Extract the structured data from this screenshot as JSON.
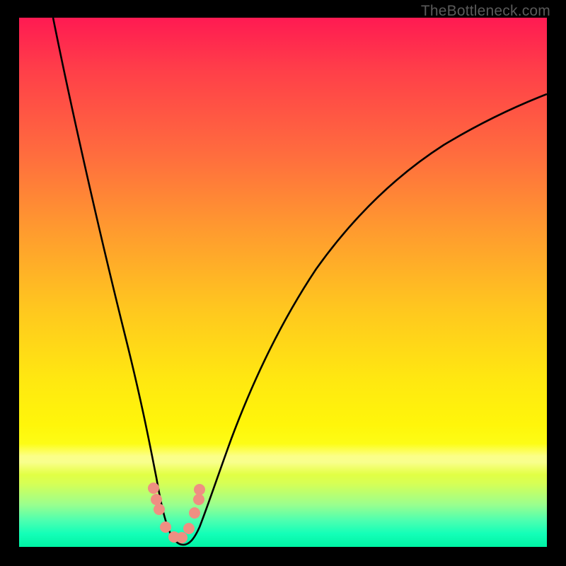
{
  "watermark": "TheBottleneck.com",
  "chart_data": {
    "type": "line",
    "title": "",
    "xlabel": "",
    "ylabel": "",
    "xlim": [
      0,
      100
    ],
    "ylim": [
      0,
      100
    ],
    "grid": false,
    "legend": false,
    "background_gradient": {
      "top": "#ff1a52",
      "mid": "#ffe711",
      "bottom": "#00f3a4"
    },
    "series": [
      {
        "name": "bottleneck-curve",
        "color": "#000000",
        "x": [
          6.5,
          9,
          12,
          15,
          18,
          21,
          23,
          25,
          26.8,
          28.5,
          30,
          31.5,
          33,
          35,
          38,
          42,
          47,
          53,
          60,
          68,
          77,
          87,
          100
        ],
        "y": [
          100,
          88,
          75,
          62,
          48,
          35,
          25,
          16,
          9,
          4,
          1.5,
          1.5,
          4,
          9.5,
          18,
          29,
          39.5,
          49,
          57,
          64,
          70,
          74.8,
          79
        ]
      },
      {
        "name": "marker-dots",
        "color": "#ef8f82",
        "type": "scatter",
        "x": [
          25.2,
          25.9,
          26.4,
          27.6,
          29.2,
          30.6,
          31.9,
          33.0,
          33.9,
          34.0
        ],
        "y": [
          11.0,
          8.8,
          7.0,
          3.8,
          2.0,
          2.0,
          3.7,
          6.6,
          9.1,
          11.0
        ]
      }
    ]
  }
}
